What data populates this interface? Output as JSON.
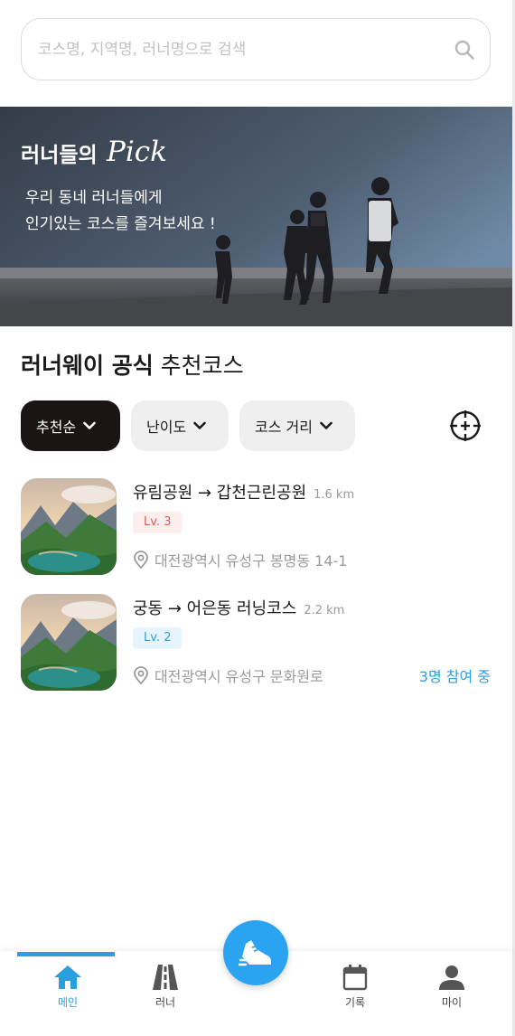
{
  "search": {
    "placeholder": "코스명, 지역명, 러너명으로 검색"
  },
  "banner": {
    "title": "러너들의",
    "title_script": "Pick",
    "subtitle_line1": "우리 동네 러너들에게",
    "subtitle_line2": "인기있는 코스를 즐겨보세요 !"
  },
  "section": {
    "title_bold": "러너웨이 공식",
    "title_rest": "추천코스"
  },
  "filters": {
    "sort": "추천순",
    "level": "난이도",
    "distance": "코스 거리"
  },
  "courses": [
    {
      "name": "유림공원 → 갑천근린공원",
      "distance": "1.6 km",
      "level": "Lv. 3",
      "address": "대전광역시 유성구 봉명동 14-1",
      "participants": ""
    },
    {
      "name": "궁동 → 어은동 러닝코스",
      "distance": "2.2 km",
      "level": "Lv. 2",
      "address": "대전광역시 유성구 문화원로",
      "participants": "3명 참여 중"
    }
  ],
  "tabs": {
    "home": "메인",
    "runner": "러너",
    "record": "기록",
    "my": "마이"
  },
  "colors": {
    "accent": "#2a9fe0",
    "chip_active": "#1c1414",
    "lv3": "#e25a5a"
  },
  "icons": [
    "search-icon",
    "chevron-down-icon",
    "crosshair-icon",
    "location-pin-icon",
    "home-icon",
    "road-icon",
    "running-shoe-icon",
    "calendar-icon",
    "person-icon"
  ]
}
